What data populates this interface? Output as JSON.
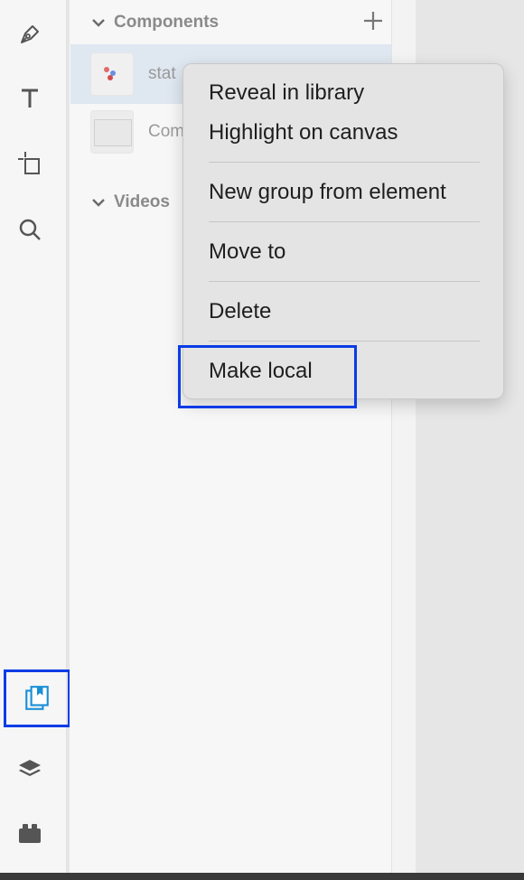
{
  "toolbar": {
    "tools": [
      {
        "name": "pen-tool",
        "icon": "pen-icon"
      },
      {
        "name": "text-tool",
        "icon": "text-icon"
      },
      {
        "name": "frame-tool",
        "icon": "frame-icon"
      },
      {
        "name": "search-tool",
        "icon": "search-icon"
      },
      {
        "name": "components-tool",
        "icon": "components-library-icon",
        "active": true
      },
      {
        "name": "layers-tool",
        "icon": "layers-icon"
      },
      {
        "name": "plugins-tool",
        "icon": "plugins-icon"
      }
    ],
    "active_color": "#1a8fd6"
  },
  "panel": {
    "components_header": "Components",
    "add_label": "+",
    "items": [
      {
        "label": "stat",
        "selected": true
      },
      {
        "label": "Com",
        "selected": false
      }
    ],
    "videos_header": "Videos"
  },
  "context_menu": {
    "items": [
      "Reveal in library",
      "Highlight on canvas",
      "New group from element",
      "Move to",
      "Delete",
      "Make local"
    ]
  },
  "colors": {
    "highlight": "#0a3ce6",
    "menu_bg": "#e4e4e4",
    "selected_row": "#dfe7f1"
  }
}
